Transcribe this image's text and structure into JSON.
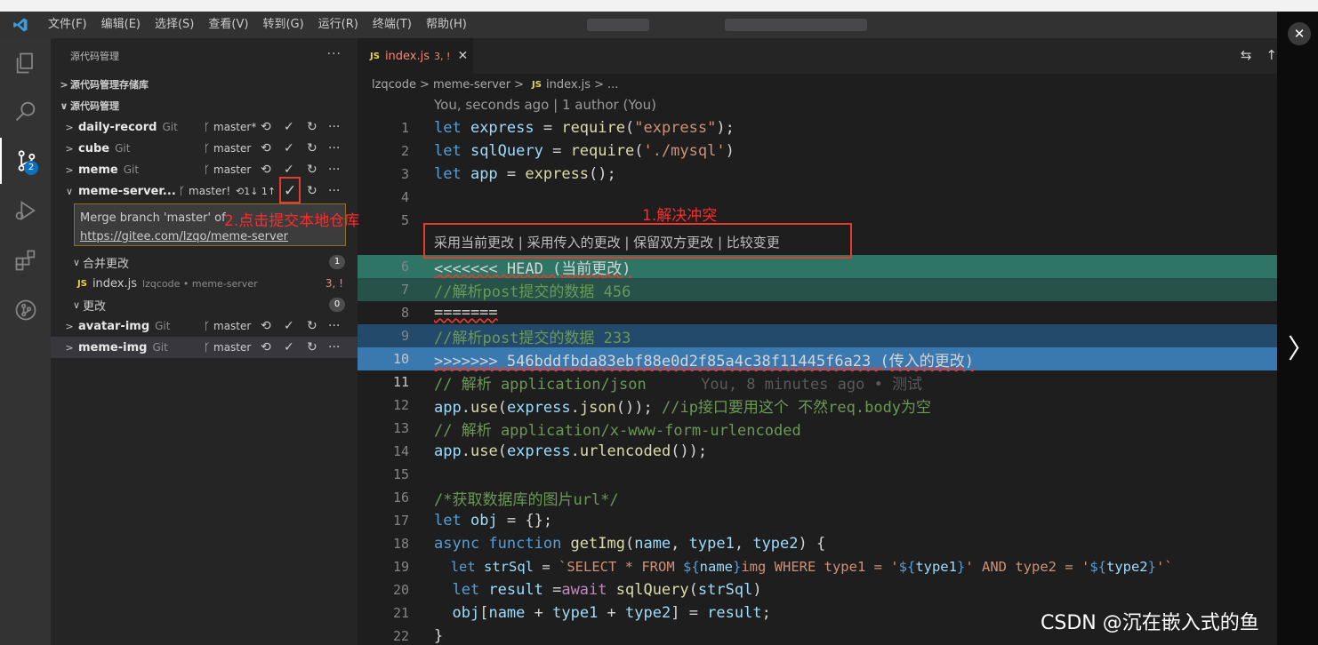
{
  "menubar": {
    "items": [
      "文件(F)",
      "编辑(E)",
      "选择(S)",
      "查看(V)",
      "转到(G)",
      "运行(R)",
      "终端(T)",
      "帮助(H)"
    ]
  },
  "sidebar": {
    "title": "源代码管理",
    "section_repos": "源代码管理存储库",
    "section_scm": "源代码管理",
    "repos": [
      {
        "name": "daily-record",
        "type": "Git",
        "branch": "master*"
      },
      {
        "name": "cube",
        "type": "Git",
        "branch": "master"
      },
      {
        "name": "meme",
        "type": "Git",
        "branch": "master"
      },
      {
        "name": "meme-server...",
        "type": "",
        "branch": "master!",
        "sync": "1↓ 1↑"
      }
    ],
    "commit_message": {
      "line1": "Merge branch 'master' of",
      "line2": "https://gitee.com/lzqo/meme-server"
    },
    "merge_changes": {
      "label": "合并更改",
      "count": "1"
    },
    "merge_file": {
      "name": "index.js",
      "path": "lzqcode • meme-server",
      "status": "3, !"
    },
    "changes": {
      "label": "更改",
      "count": "0"
    },
    "repos_after": [
      {
        "name": "avatar-img",
        "type": "Git",
        "branch": "master"
      },
      {
        "name": "meme-img",
        "type": "Git",
        "branch": "master"
      }
    ],
    "badge_count": "2"
  },
  "annotations": {
    "resolve_conflict": "1.解决冲突",
    "commit_local": "2.点击提交本地仓库"
  },
  "editor": {
    "tab": {
      "name": "index.js",
      "status": "3, !"
    },
    "breadcrumb": [
      "lzqcode",
      "meme-server",
      "index.js",
      "..."
    ],
    "blame_header": "You, seconds ago | 1 author (You)",
    "conflict_actions": "采用当前更改 | 采用传入的更改 | 保留双方更改 | 比较变更",
    "lines": {
      "l1": [
        "let ",
        "express",
        " = ",
        "require",
        "(",
        "\"express\"",
        ");"
      ],
      "l2": [
        "let ",
        "sqlQuery",
        " = ",
        "require",
        "(",
        "'./mysql'",
        ")"
      ],
      "l3": [
        "let ",
        "app",
        " = ",
        "express",
        "();"
      ],
      "l6": "<<<<<<< HEAD (当前更改)",
      "l7": "//解析post提交的数据 456",
      "l8": "=======",
      "l9": "//解析post提交的数据 233",
      "l10": ">>>>>>> 546bddfbda83ebf88e0d2f85a4c38f11445f6a23 (传入的更改)",
      "l11": "// 解析 application/json",
      "l11_blame": "You, 8 minutes ago • 测试",
      "l12": [
        "app",
        ".",
        "use",
        "(",
        "express",
        ".",
        "json",
        "()); ",
        "//ip接口要用这个 不然req.body为空"
      ],
      "l13": "// 解析 application/x-www-form-urlencoded",
      "l14": [
        "app",
        ".",
        "use",
        "(",
        "express",
        ".",
        "urlencoded",
        "());"
      ],
      "l16": "/*获取数据库的图片url*/",
      "l17": [
        "let ",
        "obj",
        " = {};"
      ],
      "l18": [
        "async ",
        "function ",
        "getImg",
        "(",
        "name",
        ", ",
        "type1",
        ", ",
        "type2",
        ") {"
      ],
      "l19": [
        "  let ",
        "strSql",
        " = ",
        "`SELECT * FROM ",
        "${",
        "name",
        "}",
        "img WHERE type1 = '",
        "${",
        "type1",
        "}",
        "' AND type2 = '",
        "${",
        "type2",
        "}",
        "'`"
      ],
      "l20": [
        "  let ",
        "result",
        " =",
        "await ",
        "sqlQuery",
        "(",
        "strSql",
        ")"
      ],
      "l21": [
        "  ",
        "obj",
        "[",
        "name",
        " + ",
        "type1",
        " + ",
        "type2",
        "] = ",
        "result",
        ";"
      ],
      "l22": "}"
    },
    "line_numbers": [
      "1",
      "2",
      "3",
      "4",
      "5",
      "6",
      "7",
      "8",
      "9",
      "10",
      "11",
      "12",
      "13",
      "14",
      "15",
      "16",
      "17",
      "18",
      "19",
      "20",
      "21",
      "22"
    ]
  },
  "watermark": "CSDN @沉在嵌入式的鱼"
}
